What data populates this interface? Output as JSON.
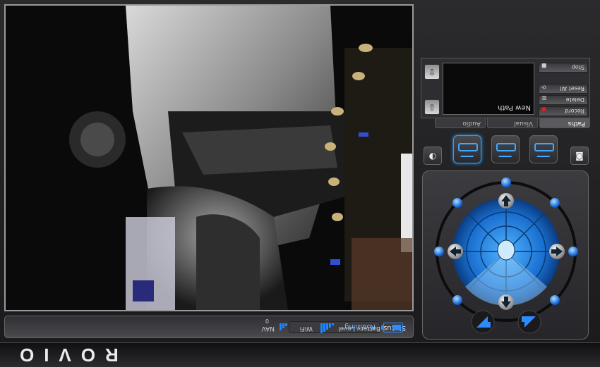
{
  "brand": {
    "logo_text": "ROVIO"
  },
  "status": {
    "label": "Status:",
    "value": "Roaming",
    "nav_label": "NAV",
    "nav_value": "0",
    "wifi_label": "WiFi",
    "battery_label": "Battery Level"
  },
  "paths_panel": {
    "tabs": [
      {
        "label": "Paths",
        "active": true
      },
      {
        "label": "Visual",
        "active": false
      },
      {
        "label": "Audio",
        "active": false
      }
    ],
    "buttons": [
      {
        "label": "Record",
        "icon": "record-icon"
      },
      {
        "label": "Delete",
        "icon": "trash-icon"
      },
      {
        "label": "Reset All",
        "icon": "reset-icon"
      },
      {
        "label": "Stop",
        "icon": "stop-icon"
      }
    ],
    "display_caption": "New Path"
  },
  "colors": {
    "accent": "#1b86ff",
    "record": "#e02020"
  }
}
